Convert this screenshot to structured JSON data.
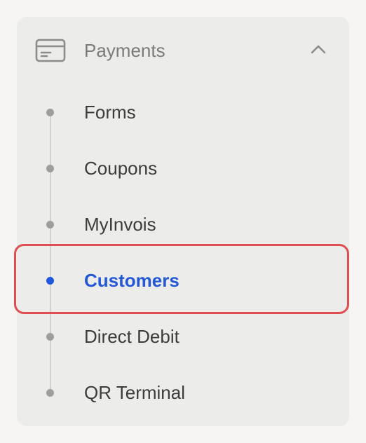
{
  "section": {
    "title": "Payments",
    "icon": "credit-card-icon",
    "toggle_icon": "chevron-up-icon",
    "expanded": true
  },
  "nav": {
    "items": [
      {
        "label": "Forms",
        "active": false
      },
      {
        "label": "Coupons",
        "active": false
      },
      {
        "label": "MyInvois",
        "active": false
      },
      {
        "label": "Customers",
        "active": true
      },
      {
        "label": "Direct Debit",
        "active": false
      },
      {
        "label": "QR Terminal",
        "active": false
      }
    ]
  },
  "colors": {
    "active": "#2458d6",
    "highlight_outline": "#df4f51",
    "panel_background": "#ececea"
  }
}
